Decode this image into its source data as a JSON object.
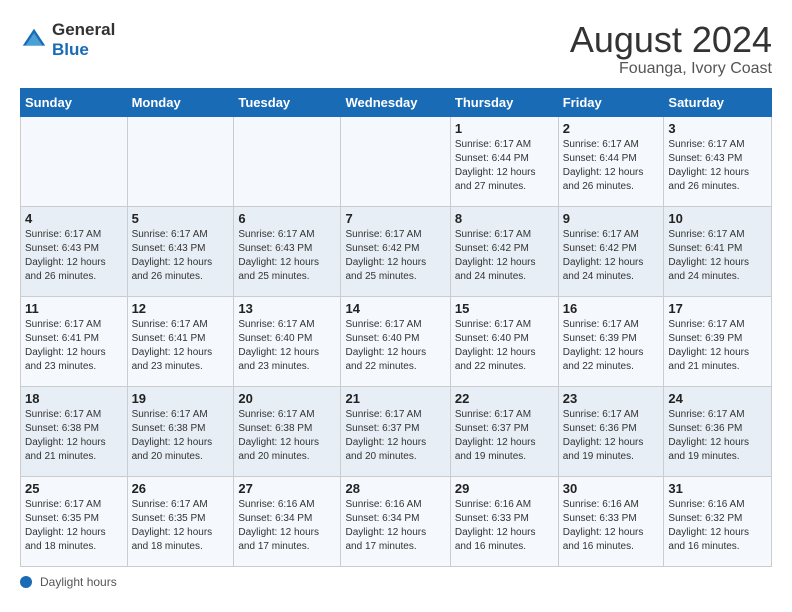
{
  "header": {
    "logo_line1": "General",
    "logo_line2": "Blue",
    "month_year": "August 2024",
    "location": "Fouanga, Ivory Coast"
  },
  "weekdays": [
    "Sunday",
    "Monday",
    "Tuesday",
    "Wednesday",
    "Thursday",
    "Friday",
    "Saturday"
  ],
  "weeks": [
    [
      {
        "day": "",
        "info": ""
      },
      {
        "day": "",
        "info": ""
      },
      {
        "day": "",
        "info": ""
      },
      {
        "day": "",
        "info": ""
      },
      {
        "day": "1",
        "info": "Sunrise: 6:17 AM\nSunset: 6:44 PM\nDaylight: 12 hours\nand 27 minutes."
      },
      {
        "day": "2",
        "info": "Sunrise: 6:17 AM\nSunset: 6:44 PM\nDaylight: 12 hours\nand 26 minutes."
      },
      {
        "day": "3",
        "info": "Sunrise: 6:17 AM\nSunset: 6:43 PM\nDaylight: 12 hours\nand 26 minutes."
      }
    ],
    [
      {
        "day": "4",
        "info": "Sunrise: 6:17 AM\nSunset: 6:43 PM\nDaylight: 12 hours\nand 26 minutes."
      },
      {
        "day": "5",
        "info": "Sunrise: 6:17 AM\nSunset: 6:43 PM\nDaylight: 12 hours\nand 26 minutes."
      },
      {
        "day": "6",
        "info": "Sunrise: 6:17 AM\nSunset: 6:43 PM\nDaylight: 12 hours\nand 25 minutes."
      },
      {
        "day": "7",
        "info": "Sunrise: 6:17 AM\nSunset: 6:42 PM\nDaylight: 12 hours\nand 25 minutes."
      },
      {
        "day": "8",
        "info": "Sunrise: 6:17 AM\nSunset: 6:42 PM\nDaylight: 12 hours\nand 24 minutes."
      },
      {
        "day": "9",
        "info": "Sunrise: 6:17 AM\nSunset: 6:42 PM\nDaylight: 12 hours\nand 24 minutes."
      },
      {
        "day": "10",
        "info": "Sunrise: 6:17 AM\nSunset: 6:41 PM\nDaylight: 12 hours\nand 24 minutes."
      }
    ],
    [
      {
        "day": "11",
        "info": "Sunrise: 6:17 AM\nSunset: 6:41 PM\nDaylight: 12 hours\nand 23 minutes."
      },
      {
        "day": "12",
        "info": "Sunrise: 6:17 AM\nSunset: 6:41 PM\nDaylight: 12 hours\nand 23 minutes."
      },
      {
        "day": "13",
        "info": "Sunrise: 6:17 AM\nSunset: 6:40 PM\nDaylight: 12 hours\nand 23 minutes."
      },
      {
        "day": "14",
        "info": "Sunrise: 6:17 AM\nSunset: 6:40 PM\nDaylight: 12 hours\nand 22 minutes."
      },
      {
        "day": "15",
        "info": "Sunrise: 6:17 AM\nSunset: 6:40 PM\nDaylight: 12 hours\nand 22 minutes."
      },
      {
        "day": "16",
        "info": "Sunrise: 6:17 AM\nSunset: 6:39 PM\nDaylight: 12 hours\nand 22 minutes."
      },
      {
        "day": "17",
        "info": "Sunrise: 6:17 AM\nSunset: 6:39 PM\nDaylight: 12 hours\nand 21 minutes."
      }
    ],
    [
      {
        "day": "18",
        "info": "Sunrise: 6:17 AM\nSunset: 6:38 PM\nDaylight: 12 hours\nand 21 minutes."
      },
      {
        "day": "19",
        "info": "Sunrise: 6:17 AM\nSunset: 6:38 PM\nDaylight: 12 hours\nand 20 minutes."
      },
      {
        "day": "20",
        "info": "Sunrise: 6:17 AM\nSunset: 6:38 PM\nDaylight: 12 hours\nand 20 minutes."
      },
      {
        "day": "21",
        "info": "Sunrise: 6:17 AM\nSunset: 6:37 PM\nDaylight: 12 hours\nand 20 minutes."
      },
      {
        "day": "22",
        "info": "Sunrise: 6:17 AM\nSunset: 6:37 PM\nDaylight: 12 hours\nand 19 minutes."
      },
      {
        "day": "23",
        "info": "Sunrise: 6:17 AM\nSunset: 6:36 PM\nDaylight: 12 hours\nand 19 minutes."
      },
      {
        "day": "24",
        "info": "Sunrise: 6:17 AM\nSunset: 6:36 PM\nDaylight: 12 hours\nand 19 minutes."
      }
    ],
    [
      {
        "day": "25",
        "info": "Sunrise: 6:17 AM\nSunset: 6:35 PM\nDaylight: 12 hours\nand 18 minutes."
      },
      {
        "day": "26",
        "info": "Sunrise: 6:17 AM\nSunset: 6:35 PM\nDaylight: 12 hours\nand 18 minutes."
      },
      {
        "day": "27",
        "info": "Sunrise: 6:16 AM\nSunset: 6:34 PM\nDaylight: 12 hours\nand 17 minutes."
      },
      {
        "day": "28",
        "info": "Sunrise: 6:16 AM\nSunset: 6:34 PM\nDaylight: 12 hours\nand 17 minutes."
      },
      {
        "day": "29",
        "info": "Sunrise: 6:16 AM\nSunset: 6:33 PM\nDaylight: 12 hours\nand 16 minutes."
      },
      {
        "day": "30",
        "info": "Sunrise: 6:16 AM\nSunset: 6:33 PM\nDaylight: 12 hours\nand 16 minutes."
      },
      {
        "day": "31",
        "info": "Sunrise: 6:16 AM\nSunset: 6:32 PM\nDaylight: 12 hours\nand 16 minutes."
      }
    ]
  ],
  "footer": {
    "label": "Daylight hours"
  }
}
